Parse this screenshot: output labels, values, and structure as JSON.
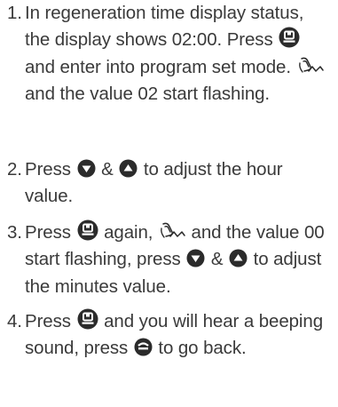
{
  "steps": [
    {
      "number": "1.",
      "t1": "In regeneration time display status, the display shows 02:00. Press ",
      "t2": " and enter into program set mode. ",
      "t3": " and the value 02 start flashing."
    },
    {
      "number": "2.",
      "t1": "Press ",
      "t2": " & ",
      "t3": " to adjust the hour value."
    },
    {
      "number": "3.",
      "t1": "Press ",
      "t2": " again, ",
      "t3": " and the value 00 start flashing, press ",
      "t4": " & ",
      "t5": " to adjust the minutes value."
    },
    {
      "number": "4.",
      "t1": "Press ",
      "t2": " and you will hear a beeping sound, press ",
      "t3": " to go back."
    }
  ],
  "icons": {
    "program": "program-set-button-icon",
    "flash": "flashing-indicator-icon",
    "down": "down-arrow-button-icon",
    "up": "up-arrow-button-icon",
    "back": "back-button-icon"
  },
  "colors": {
    "text": "#3a3a3a",
    "icon": "#2b2b2b"
  }
}
